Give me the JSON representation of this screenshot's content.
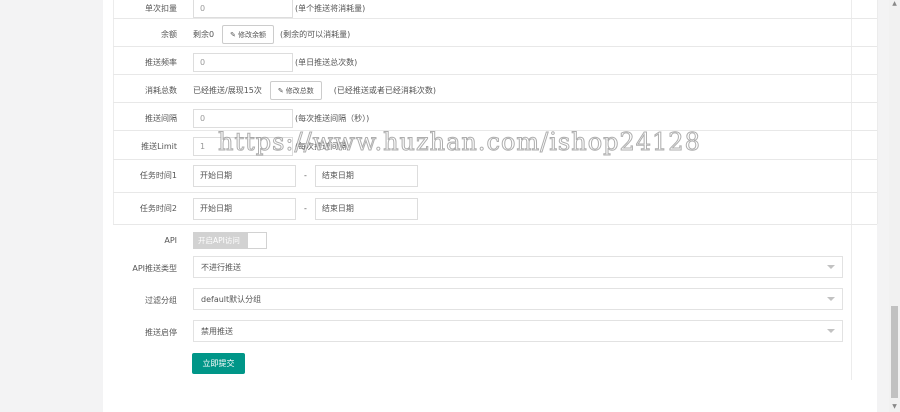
{
  "fields": {
    "single_deduct": {
      "label": "单次扣量",
      "value": "0",
      "hint": "(单个推送将消耗量)"
    },
    "balance": {
      "label": "余额",
      "text": "剩余0",
      "button": "修改余额",
      "hint": "(剩余的可以消耗量)"
    },
    "push_freq": {
      "label": "推送频率",
      "value": "0",
      "hint": "(单日推送总次数)"
    },
    "consume_total": {
      "label": "消耗总数",
      "text": "已经推送/展现15次",
      "button": "修改总数",
      "hint": "(已经推送或者已经消耗次数)"
    },
    "push_interval": {
      "label": "推送间隔",
      "value": "0",
      "hint": "(每次推送间隔（秒）)"
    },
    "push_limit": {
      "label": "推送Limit",
      "value": "1",
      "hint": "(每次推送间隔)"
    },
    "task_time1": {
      "label": "任务时间1",
      "start": "开始日期",
      "dash": "-",
      "end": "结束日期"
    },
    "task_time2": {
      "label": "任务时间2",
      "start": "开始日期",
      "dash": "-",
      "end": "结束日期"
    },
    "api": {
      "label": "API",
      "toggle": "开启API访问"
    },
    "api_push_type": {
      "label": "API推送类型",
      "value": "不进行推送"
    },
    "filter_group": {
      "label": "过滤分组",
      "value": "default默认分组"
    },
    "push_enable": {
      "label": "推送启停",
      "value": "禁用推送"
    }
  },
  "submit_label": "立即提交",
  "watermark": "https://www.huzhan.com/ishop24128",
  "colors": {
    "primary": "#009688",
    "border": "#e2e2e2"
  }
}
